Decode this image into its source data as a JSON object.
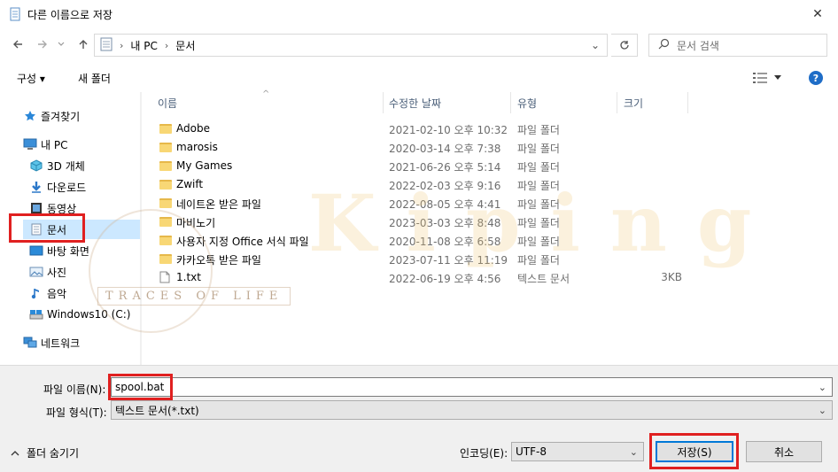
{
  "window": {
    "title": "다른 이름으로 저장",
    "close_glyph": "✕"
  },
  "nav": {
    "breadcrumb": [
      "내 PC",
      "문서"
    ],
    "search_placeholder": "문서 검색"
  },
  "toolbar": {
    "organize_label": "구성 ▾",
    "new_folder_label": "새 폴더",
    "help_label": "?"
  },
  "sidebar": {
    "items": [
      {
        "label": "즐겨찾기",
        "icon": "star-icon"
      },
      {
        "label": "내 PC",
        "icon": "computer-icon"
      },
      {
        "label": "3D 개체",
        "icon": "cube-icon"
      },
      {
        "label": "다운로드",
        "icon": "download-icon"
      },
      {
        "label": "동영상",
        "icon": "video-icon"
      },
      {
        "label": "문서",
        "icon": "document-icon"
      },
      {
        "label": "바탕 화면",
        "icon": "desktop-icon"
      },
      {
        "label": "사진",
        "icon": "picture-icon"
      },
      {
        "label": "음악",
        "icon": "music-icon"
      },
      {
        "label": "Windows10 (C:)",
        "icon": "drive-icon"
      },
      {
        "label": "네트워크",
        "icon": "network-icon"
      }
    ]
  },
  "columns": {
    "name": "이름",
    "modified": "수정한 날짜",
    "type": "유형",
    "size": "크기"
  },
  "files": [
    {
      "name": "Adobe",
      "modified": "2021-02-10 오후 10:32",
      "type": "파일 폴더",
      "size": "",
      "kind": "folder"
    },
    {
      "name": "marosis",
      "modified": "2020-03-14 오후 7:38",
      "type": "파일 폴더",
      "size": "",
      "kind": "folder"
    },
    {
      "name": "My Games",
      "modified": "2021-06-26 오후 5:14",
      "type": "파일 폴더",
      "size": "",
      "kind": "folder"
    },
    {
      "name": "Zwift",
      "modified": "2022-02-03 오후 9:16",
      "type": "파일 폴더",
      "size": "",
      "kind": "folder"
    },
    {
      "name": "네이트온 받은 파일",
      "modified": "2022-08-05 오후 4:41",
      "type": "파일 폴더",
      "size": "",
      "kind": "folder"
    },
    {
      "name": "마비노기",
      "modified": "2023-03-03 오후 8:48",
      "type": "파일 폴더",
      "size": "",
      "kind": "folder"
    },
    {
      "name": "사용자 지정 Office 서식 파일",
      "modified": "2020-11-08 오후 6:58",
      "type": "파일 폴더",
      "size": "",
      "kind": "folder"
    },
    {
      "name": "카카오톡 받은 파일",
      "modified": "2023-07-11 오후 11:19",
      "type": "파일 폴더",
      "size": "",
      "kind": "folder"
    },
    {
      "name": "1.txt",
      "modified": "2022-06-19 오후 4:56",
      "type": "텍스트 문서",
      "size": "3KB",
      "kind": "file"
    }
  ],
  "watermark": {
    "main": "Kiping",
    "sub": "TRACES OF LIFE"
  },
  "form": {
    "filename_label": "파일 이름(N):",
    "filename_value": "spool.bat",
    "filetype_label": "파일 형식(T):",
    "filetype_value": "텍스트 문서(*.txt)",
    "encoding_label": "인코딩(E):",
    "encoding_value": "UTF-8",
    "save_label": "저장(S)",
    "cancel_label": "취소",
    "hide_folders_label": "폴더 숨기기"
  },
  "colors": {
    "highlight": "#e02020",
    "selected_bg": "#cce8ff",
    "accent": "#0078d7"
  }
}
